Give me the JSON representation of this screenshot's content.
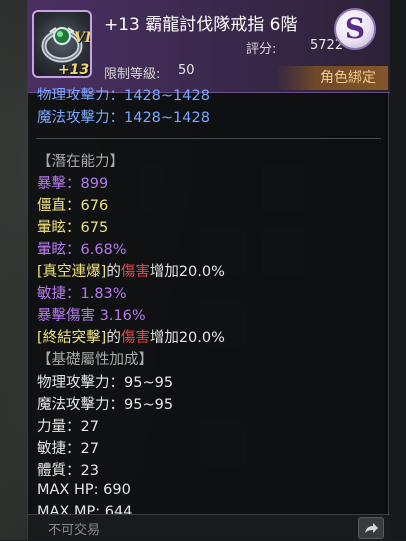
{
  "item": {
    "tier": "VI",
    "enhancement": "+13",
    "name": "+13 霸龍討伐隊戒指 6階",
    "score_label": "評分:",
    "score_value": "5722",
    "level_label": "限制等級:",
    "level_value": "50",
    "grade": "S",
    "bound": "角色綁定",
    "icon": "ring-icon"
  },
  "stats_top": [
    {
      "text": "物理攻擊力：1428~1428",
      "color": "blue"
    },
    {
      "text": "魔法攻擊力：1428~1428",
      "color": "blue"
    }
  ],
  "latent": {
    "header": "【潛在能力】",
    "lines": [
      {
        "text": "暴擊：899"
      },
      {
        "text": "僵直：676"
      },
      {
        "text": "暈眩：675"
      },
      {
        "text": "暈眩：6.68%"
      }
    ]
  },
  "skill_bonus_1": {
    "skill": "[真空連爆]",
    "mid": "的",
    "attr": "傷害",
    "tail": "增加20.0%"
  },
  "extra_lines": [
    {
      "text": "敏捷：1.83%"
    },
    {
      "text": "暴擊傷害 3.16%"
    }
  ],
  "skill_bonus_2": {
    "skill": "[終結突擊]",
    "mid": "的",
    "attr": "傷害",
    "tail": "增加20.0%"
  },
  "base": {
    "header": "【基礎屬性加成】",
    "lines": [
      {
        "text": "物理攻擊力：95~95"
      },
      {
        "text": "魔法攻擊力：95~95"
      },
      {
        "text": "力量：27"
      },
      {
        "text": "敏捷：27"
      },
      {
        "text": "體質：23"
      },
      {
        "text": "MAX HP:  690"
      },
      {
        "text": "MAX MP:  644"
      }
    ]
  },
  "footer": {
    "untradeable": "不可交易",
    "share_icon": "share-arrow-icon"
  },
  "colors": {
    "header_bg": "#4b2f63",
    "blue": "#7aa7ff",
    "purple": "#b679ef",
    "yellow": "#f0e27a",
    "red": "#e24747",
    "white": "#e6e6e6",
    "bound_text": "#f2c98a"
  }
}
